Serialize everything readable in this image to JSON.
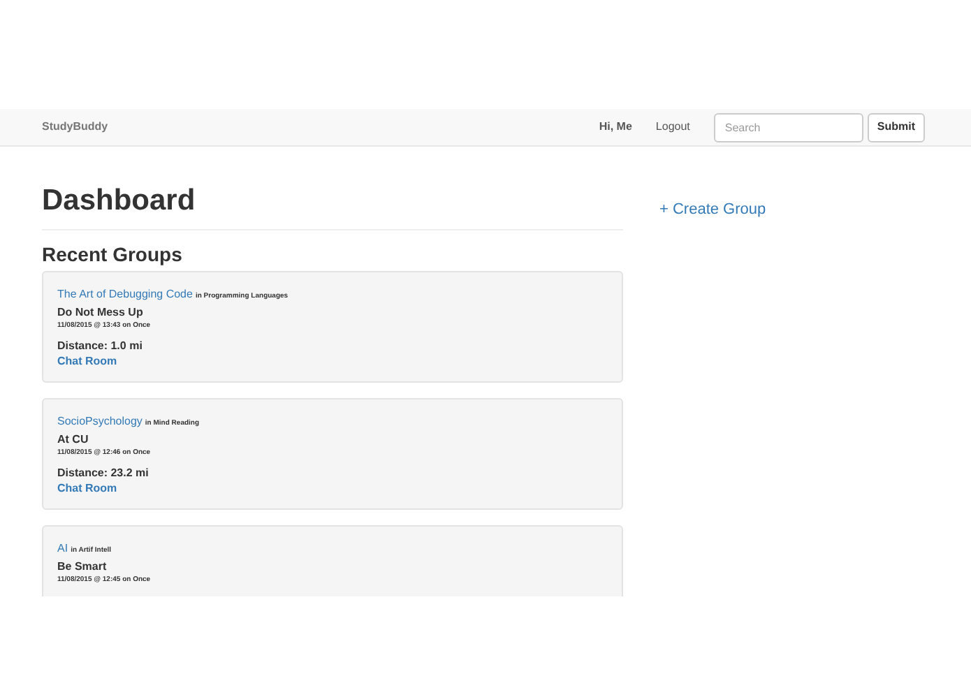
{
  "navbar": {
    "brand": "StudyBuddy",
    "greeting": "Hi, Me",
    "logout": "Logout",
    "search": {
      "placeholder": "Search"
    },
    "submit": "Submit"
  },
  "heading": "Dashboard",
  "create_group": "+ Create Group",
  "recent_groups": {
    "title": "Recent Groups",
    "groups": [
      {
        "name": "The Art of Debugging Code",
        "category": "in Programming Languages",
        "description": "Do Not Mess Up",
        "schedule": "11/08/2015 @ 13:43 on Once",
        "distance": "Distance: 1.0 mi",
        "link": "Chat Room"
      },
      {
        "name": "SocioPsychology",
        "category": "in Mind Reading",
        "description": "At CU",
        "schedule": "11/08/2015 @ 12:46 on Once",
        "distance": "Distance: 23.2 mi",
        "link": "Chat Room"
      },
      {
        "name": "AI",
        "category": "in Artif Intell",
        "description": "Be Smart",
        "schedule": "11/08/2015 @ 12:45 on Once"
      }
    ]
  }
}
